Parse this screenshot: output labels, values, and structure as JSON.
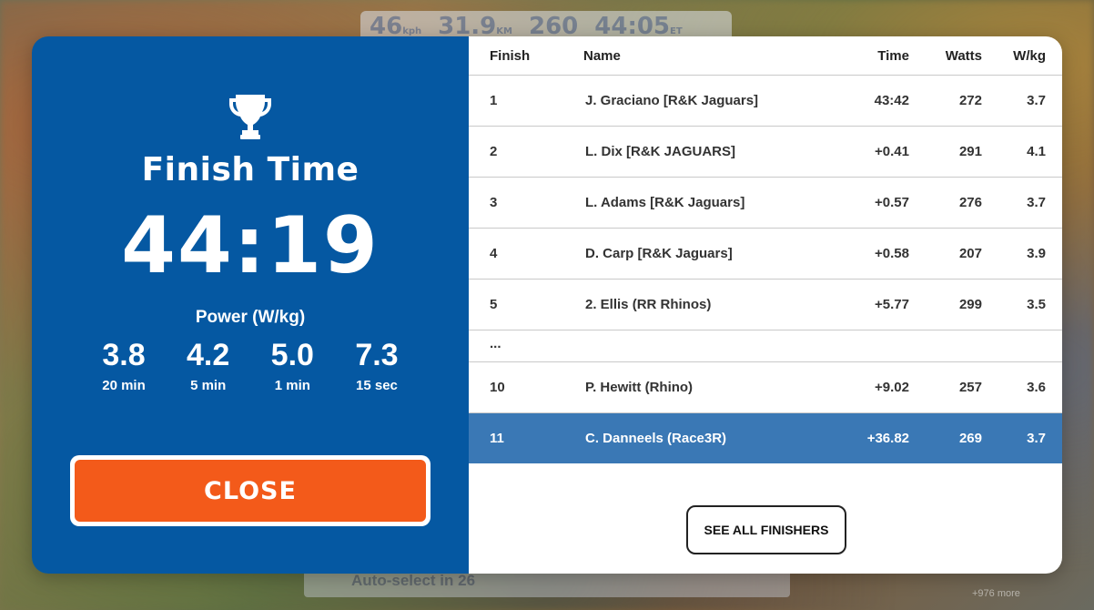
{
  "background": {
    "hud": {
      "speed": "46",
      "speed_unit": "kph",
      "distance": "31.9",
      "distance_unit": "KM",
      "power": "260",
      "time": "44:05",
      "time_unit": "ET"
    },
    "auto_select": "Auto-select in 26",
    "more_text": "+976 more"
  },
  "summary": {
    "trophy_icon": "trophy-icon",
    "title": "Finish Time",
    "finish_time": "44:19",
    "power_label": "Power (W/kg)",
    "power": [
      {
        "value": "3.8",
        "label": "20 min"
      },
      {
        "value": "4.2",
        "label": "5 min"
      },
      {
        "value": "5.0",
        "label": "1 min"
      },
      {
        "value": "7.3",
        "label": "15 sec"
      }
    ],
    "close_label": "CLOSE"
  },
  "results": {
    "columns": {
      "finish": "Finish",
      "name": "Name",
      "time": "Time",
      "watts": "Watts",
      "wkg": "W/kg"
    },
    "rows": [
      {
        "finish": "1",
        "name": "J. Graciano [R&K Jaguars]",
        "time": "43:42",
        "watts": "272",
        "wkg": "3.7"
      },
      {
        "finish": "2",
        "name": "L. Dix [R&K JAGUARS]",
        "time": "+0.41",
        "watts": "291",
        "wkg": "4.1"
      },
      {
        "finish": "3",
        "name": "L. Adams [R&K Jaguars]",
        "time": "+0.57",
        "watts": "276",
        "wkg": "3.7"
      },
      {
        "finish": "4",
        "name": "D. Carp [R&K Jaguars]",
        "time": "+0.58",
        "watts": "207",
        "wkg": "3.9"
      },
      {
        "finish": "5",
        "name": "2. Ellis (RR Rhinos)",
        "time": "+5.77",
        "watts": "299",
        "wkg": "3.5"
      }
    ],
    "ellipsis": "...",
    "rows_after": [
      {
        "finish": "10",
        "name": "P. Hewitt (Rhino)",
        "time": "+9.02",
        "watts": "257",
        "wkg": "3.6"
      },
      {
        "finish": "11",
        "name": "C. Danneels (Race3R)",
        "time": "+36.82",
        "watts": "269",
        "wkg": "3.7",
        "highlighted": true
      }
    ],
    "see_all_label": "SEE ALL FINISHERS"
  },
  "colors": {
    "panel_blue": "#0558a2",
    "highlight_row": "#3a78b5",
    "close_orange": "#f35a1a"
  }
}
